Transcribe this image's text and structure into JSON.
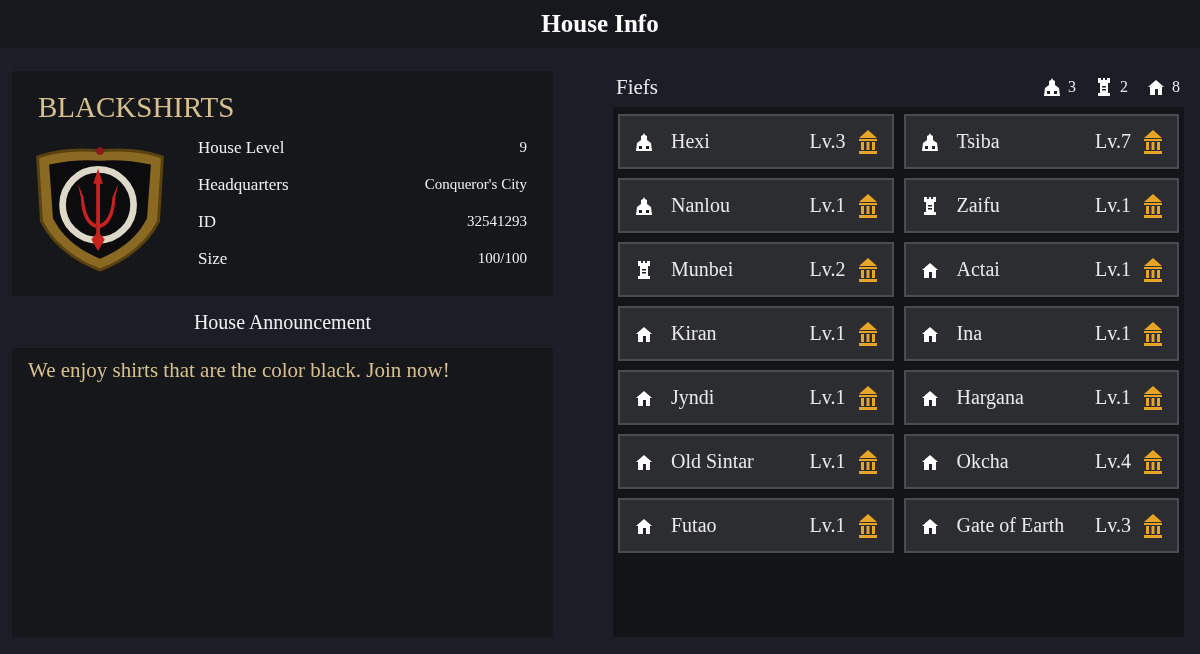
{
  "header": {
    "title": "House Info"
  },
  "house": {
    "name": "BLACKSHIRTS",
    "stats": [
      {
        "label": "House Level",
        "value": "9"
      },
      {
        "label": "Headquarters",
        "value": "Conqueror's City"
      },
      {
        "label": "ID",
        "value": "32541293"
      },
      {
        "label": "Size",
        "value": "100/100"
      }
    ]
  },
  "announcement": {
    "heading": "House Announcement",
    "text": "We enjoy shirts that are the color black. Join now!"
  },
  "fiefs": {
    "title": "Fiefs",
    "counts": [
      {
        "kind": "town",
        "count": "3"
      },
      {
        "kind": "castle",
        "count": "2"
      },
      {
        "kind": "village",
        "count": "8"
      }
    ],
    "items": [
      {
        "kind": "town",
        "name": "Hexi",
        "level": "Lv.3"
      },
      {
        "kind": "town",
        "name": "Tsiba",
        "level": "Lv.7"
      },
      {
        "kind": "town",
        "name": "Nanlou",
        "level": "Lv.1"
      },
      {
        "kind": "castle",
        "name": "Zaifu",
        "level": "Lv.1"
      },
      {
        "kind": "castle",
        "name": "Munbei",
        "level": "Lv.2"
      },
      {
        "kind": "village",
        "name": "Actai",
        "level": "Lv.1"
      },
      {
        "kind": "village",
        "name": "Kiran",
        "level": "Lv.1"
      },
      {
        "kind": "village",
        "name": "Ina",
        "level": "Lv.1"
      },
      {
        "kind": "village",
        "name": "Jyndi",
        "level": "Lv.1"
      },
      {
        "kind": "village",
        "name": "Hargana",
        "level": "Lv.1"
      },
      {
        "kind": "village",
        "name": "Old Sintar",
        "level": "Lv.1"
      },
      {
        "kind": "village",
        "name": "Okcha",
        "level": "Lv.4"
      },
      {
        "kind": "village",
        "name": "Futao",
        "level": "Lv.1"
      },
      {
        "kind": "village",
        "name": "Gate of Earth",
        "level": "Lv.3"
      }
    ]
  }
}
